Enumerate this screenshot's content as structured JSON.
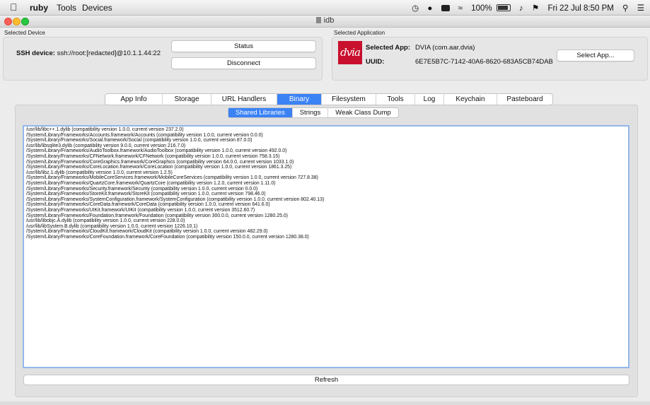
{
  "menubar": {
    "apple_icon": "apple-icon",
    "app_name": "ruby",
    "menus": [
      "Tools",
      "Devices"
    ],
    "status": {
      "battery_percent": "100%",
      "datetime": "Fri 22 Jul  8:50 PM"
    }
  },
  "window": {
    "title": "idb"
  },
  "device": {
    "section_label": "Selected Device",
    "ssh_label": "SSH device:",
    "ssh_value": "ssh://root:[redacted]@10.1.1.44:22",
    "status_button": "Status",
    "disconnect_button": "Disconnect"
  },
  "application": {
    "section_label": "Selected Application",
    "logo_text": "dvia",
    "selected_app_label": "Selected App:",
    "selected_app_value": "DVIA (com.aar.dvia)",
    "uuid_label": "UUID:",
    "uuid_value": "6E7E5B7C-7142-40A6-8620-683A5CB74DAB",
    "select_app_button": "Select App..."
  },
  "tabs": [
    "App Info",
    "Storage",
    "URL Handlers",
    "Binary",
    "Filesystem",
    "Tools",
    "Log",
    "Keychain",
    "Pasteboard"
  ],
  "active_tab": "Binary",
  "subtabs": [
    "Shared Libraries",
    "Strings",
    "Weak Class Dump"
  ],
  "active_subtab": "Shared Libraries",
  "libraries": [
    "/usr/lib/libc++.1.dylib (compatibility version 1.0.0, current version 237.2.0)",
    "/System/Library/Frameworks/Accounts.framework/Accounts (compatibility version 1.0.0, current version 0.0.0)",
    "/System/Library/Frameworks/Social.framework/Social (compatibility version 1.0.0, current version 87.0.0)",
    "/usr/lib/libsqlite3.dylib (compatibility version 9.0.0, current version 216.7.0)",
    "/System/Library/Frameworks/AudioToolbox.framework/AudioToolbox (compatibility version 1.0.0, current version 492.0.0)",
    "/System/Library/Frameworks/CFNetwork.framework/CFNetwork (compatibility version 1.0.0, current version 758.3.15)",
    "/System/Library/Frameworks/CoreGraphics.framework/CoreGraphics (compatibility version 64.0.0, current version 1033.1.0)",
    "/System/Library/Frameworks/CoreLocation.framework/CoreLocation (compatibility version 1.0.0, current version 1861.3.25)",
    "/usr/lib/libz.1.dylib (compatibility version 1.0.0, current version 1.2.5)",
    "/System/Library/Frameworks/MobileCoreServices.framework/MobileCoreServices (compatibility version 1.0.0, current version 727.8.38)",
    "/System/Library/Frameworks/QuartzCore.framework/QuartzCore (compatibility version 1.2.0, current version 1.11.0)",
    "/System/Library/Frameworks/Security.framework/Security (compatibility version 1.0.0, current version 0.0.0)",
    "/System/Library/Frameworks/StoreKit.framework/StoreKit (compatibility version 1.0.0, current version 798.46.0)",
    "/System/Library/Frameworks/SystemConfiguration.framework/SystemConfiguration (compatibility version 1.0.0, current version 802.40.13)",
    "/System/Library/Frameworks/CoreData.framework/CoreData (compatibility version 1.0.0, current version 641.6.0)",
    "/System/Library/Frameworks/UIKit.framework/UIKit (compatibility version 1.0.0, current version 3512.60.7)",
    "/System/Library/Frameworks/Foundation.framework/Foundation (compatibility version 300.0.0, current version 1280.25.0)",
    "/usr/lib/libobjc.A.dylib (compatibility version 1.0.0, current version 228.0.0)",
    "/usr/lib/libSystem.B.dylib (compatibility version 1.0.0, current version 1226.10.1)",
    "/System/Library/Frameworks/CloudKit.framework/CloudKit (compatibility version 1.0.0, current version 482.29.0)",
    "/System/Library/Frameworks/CoreFoundation.framework/CoreFoundation (compatibility version 150.0.0, current version 1280.38.0)"
  ],
  "refresh_button": "Refresh",
  "colors": {
    "accent": "#3b82f5",
    "logo_bg": "#c8102e"
  }
}
